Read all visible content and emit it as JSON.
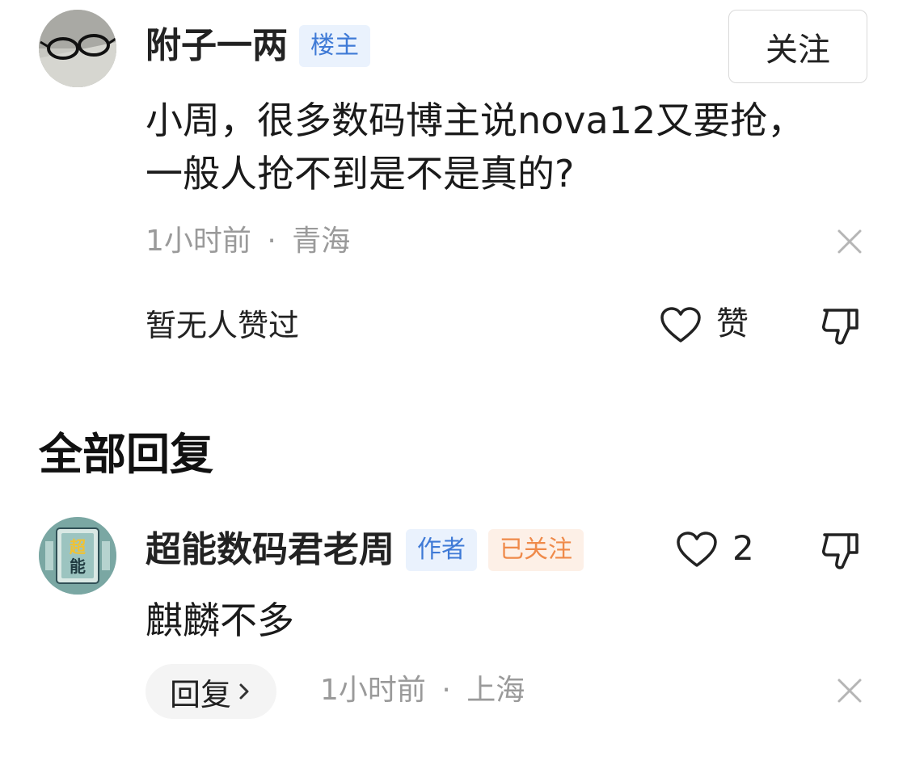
{
  "op": {
    "username": "附子一两",
    "badge": "楼主",
    "follow_label": "关注",
    "content": "小周，很多数码博主说nova12又要抢，一般人抢不到是不是真的?",
    "time": "1小时前",
    "location": "青海",
    "separator": "·",
    "no_likes_text": "暂无人赞过",
    "like_label": "赞"
  },
  "replies_section": {
    "title": "全部回复"
  },
  "reply": {
    "username": "超能数码君老周",
    "author_badge": "作者",
    "followed_badge": "已关注",
    "avatar_text": "超能",
    "like_count": "2",
    "content": "麒麟不多",
    "reply_label": "回复",
    "time": "1小时前",
    "location": "上海",
    "separator": "·"
  },
  "icons": {
    "heart": "heart-outline-icon",
    "dislike": "thumbs-down-icon",
    "close": "close-icon",
    "chevron": "chevron-right-icon"
  },
  "colors": {
    "blue_badge_text": "#3f7ad6",
    "blue_badge_bg": "#eaf2fd",
    "orange_badge_text": "#ef8a4a",
    "orange_badge_bg": "#fdf0e7",
    "meta_gray": "#9a9a9a"
  }
}
